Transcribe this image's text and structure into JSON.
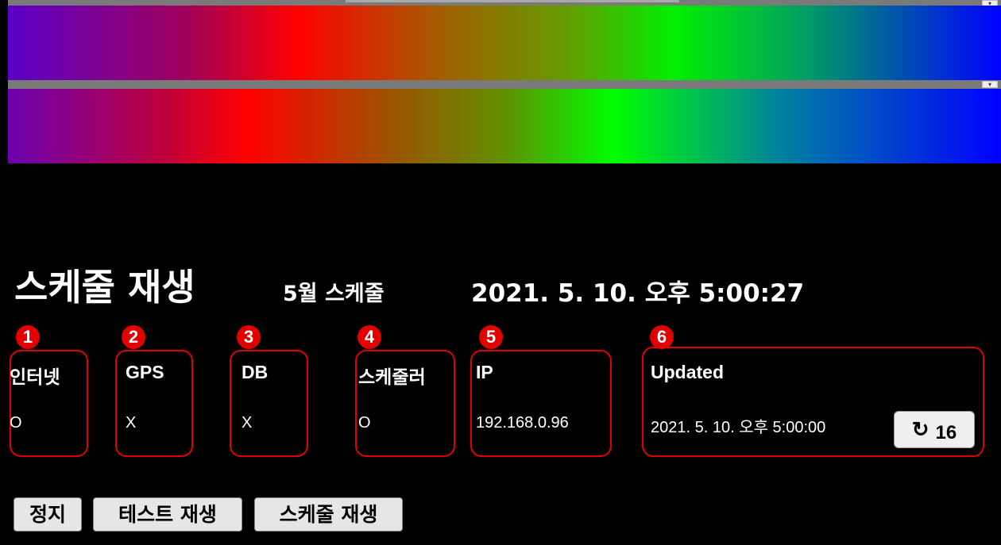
{
  "header": {
    "title": "스케줄 재생",
    "schedule_name": "5월 스케줄",
    "current_time": "2021. 5. 10. 오후 5:00:27"
  },
  "preview_bars": [
    {
      "name": "preview-1",
      "colors": [
        "#5a00c8",
        "#ff0000",
        "#00f000",
        "#0000ff"
      ]
    },
    {
      "name": "preview-2",
      "colors": [
        "#6a00b0",
        "#ff0000",
        "#00ff00",
        "#0000ff"
      ]
    }
  ],
  "callouts": [
    "1",
    "2",
    "3",
    "4",
    "5",
    "6"
  ],
  "status": {
    "internet": {
      "label": "인터넷",
      "value": "O"
    },
    "gps": {
      "label": "GPS",
      "value": "X"
    },
    "db": {
      "label": "DB",
      "value": "X"
    },
    "scheduler": {
      "label": "스케줄러",
      "value": "O"
    },
    "ip": {
      "label": "IP",
      "value": "192.168.0.96"
    },
    "updated": {
      "label": "Updated",
      "value": "2021. 5. 10. 오후 5:00:00",
      "refresh_count": "16",
      "refresh_icon": "refresh-icon"
    }
  },
  "buttons": {
    "stop": "정지",
    "test_play": "테스트 재생",
    "schedule_play": "스케줄 재생"
  },
  "colors": {
    "background": "#000000",
    "highlight": "#e00000",
    "button_bg": "#e6e6e6"
  }
}
